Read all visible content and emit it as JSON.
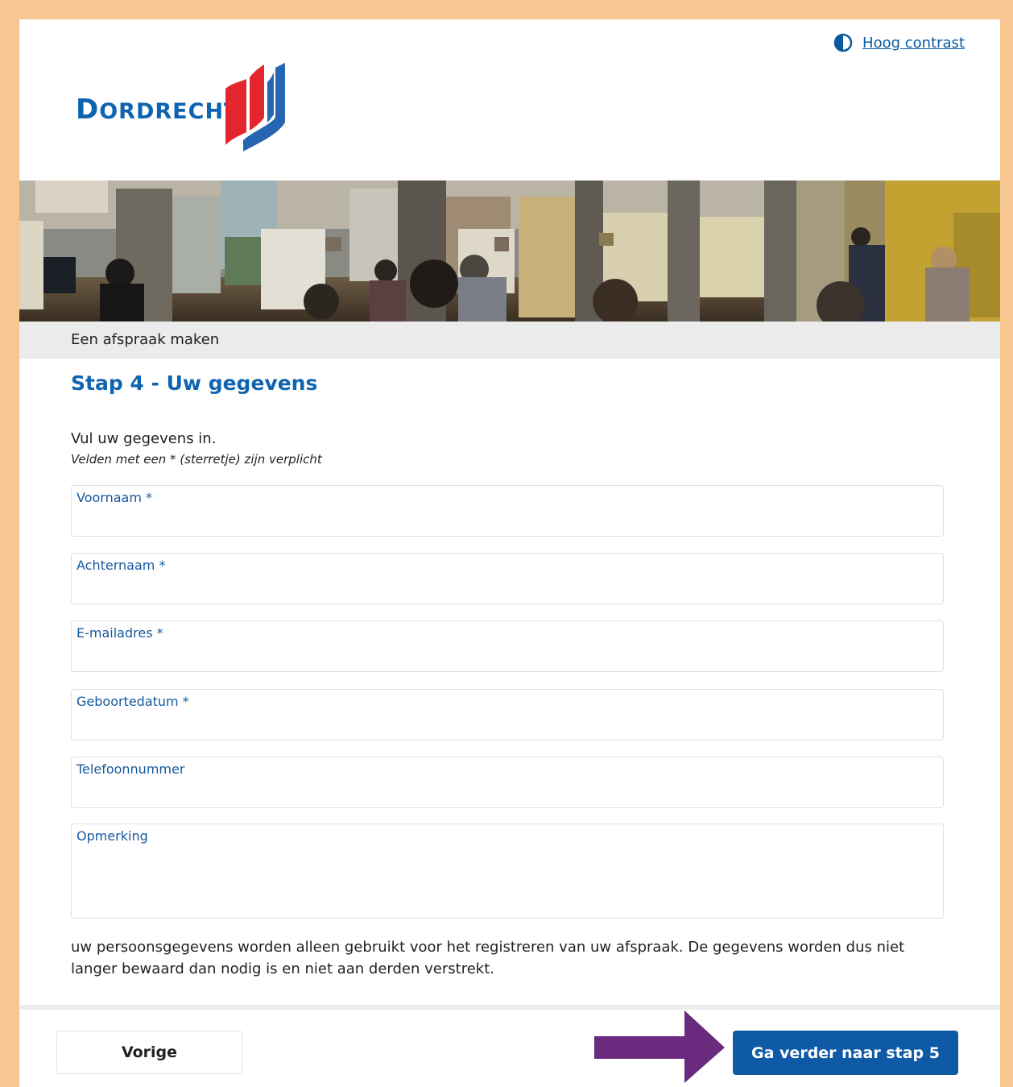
{
  "header": {
    "contrast_label": "Hoog contrast",
    "logo_text": "Dordrecht"
  },
  "breadcrumb": "Een afspraak maken",
  "step_title": "Stap 4 - Uw gegevens",
  "intro": "Vul uw gegevens in.",
  "required_hint": "Velden met een * (sterretje) zijn verplicht",
  "fields": [
    {
      "label": "Voornaam *",
      "value": ""
    },
    {
      "label": "Achternaam *",
      "value": ""
    },
    {
      "label": "E-mailadres *",
      "value": ""
    },
    {
      "label": "Geboortedatum *",
      "value": ""
    },
    {
      "label": "Telefoonnummer",
      "value": ""
    },
    {
      "label": "Opmerking",
      "value": ""
    }
  ],
  "privacy_text": "uw persoonsgegevens worden alleen gebruikt voor het registreren van uw afspraak. De gegevens worden dus niet langer bewaard dan nodig is en niet aan derden verstrekt.",
  "buttons": {
    "previous": "Vorige",
    "next": "Ga verder naar stap 5"
  },
  "colors": {
    "brand_blue": "#0e64b0",
    "button_blue": "#0e5aa7",
    "logo_red": "#e3262e",
    "arrow_purple": "#6a2a7e",
    "frame_orange": "#f7c691"
  },
  "icons": {
    "contrast": "half-circle-contrast-icon",
    "annotation": "arrow-right-icon"
  }
}
